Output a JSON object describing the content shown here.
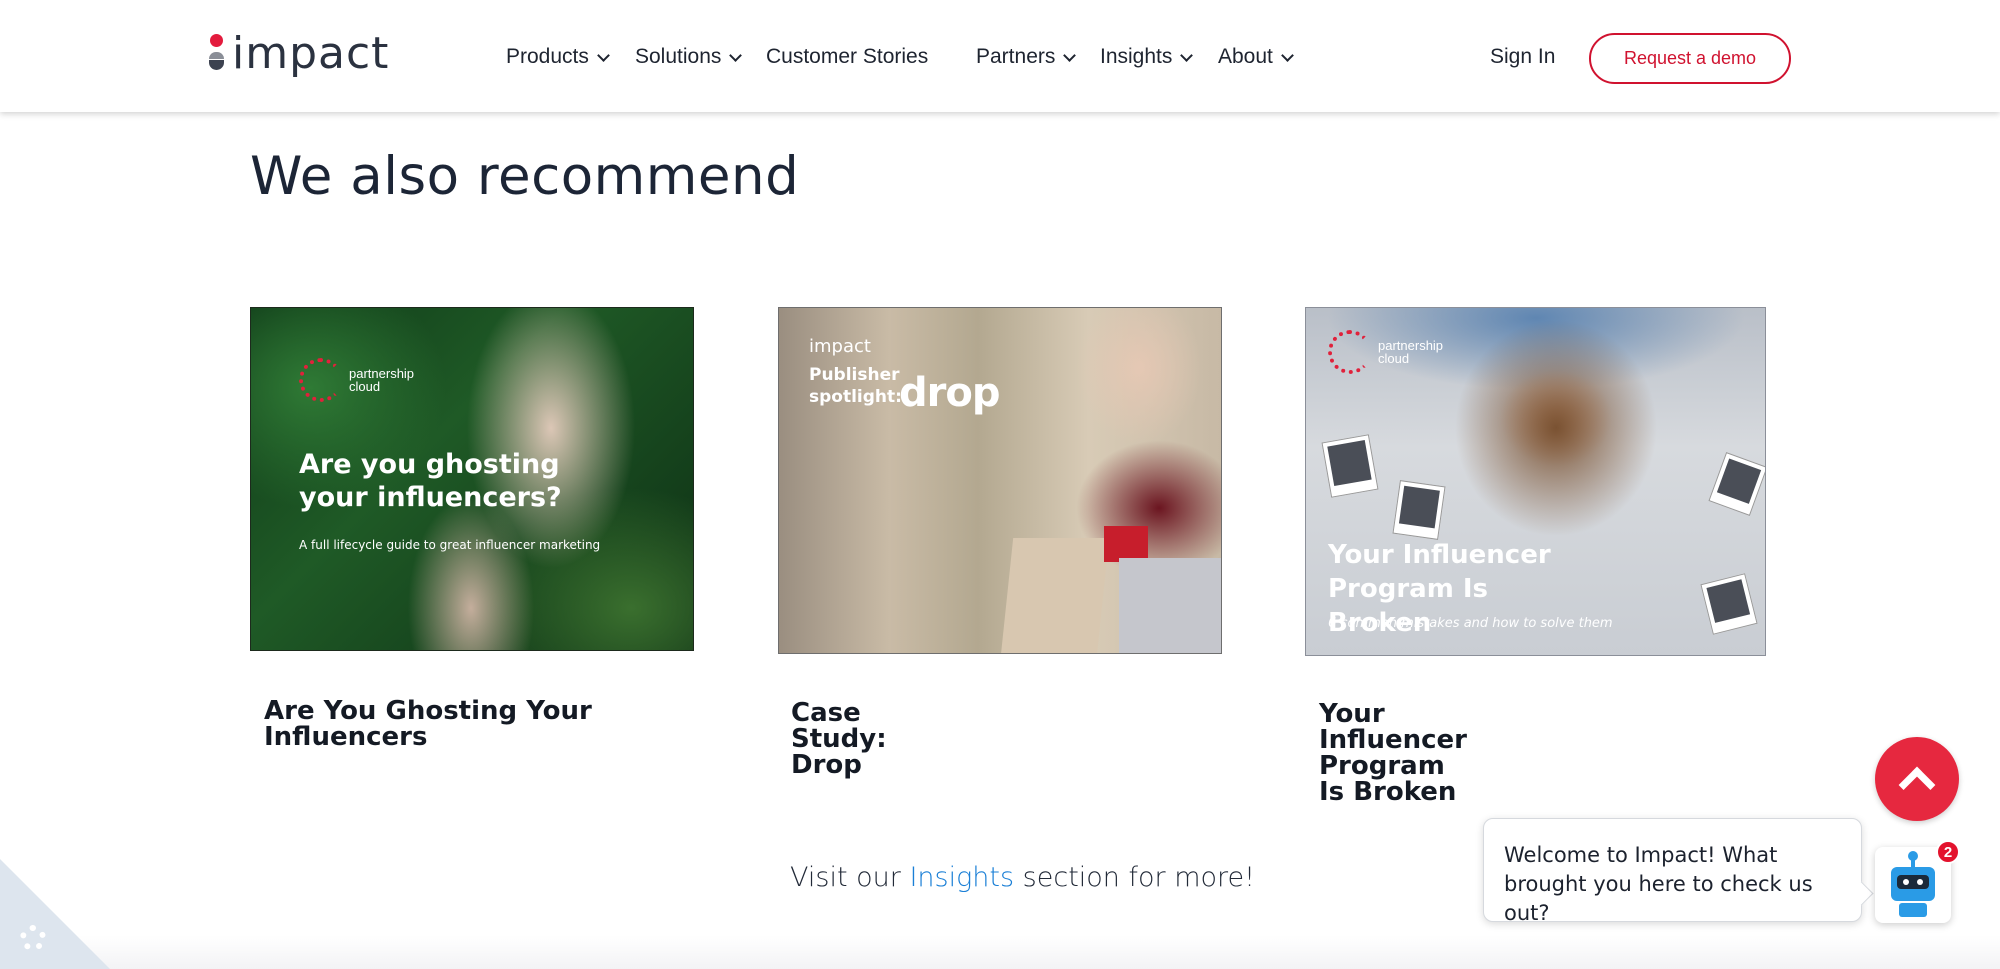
{
  "header": {
    "logo_text": "impact",
    "nav": [
      {
        "label": "Products",
        "has_dropdown": true
      },
      {
        "label": "Solutions",
        "has_dropdown": true
      },
      {
        "label": "Customer Stories",
        "has_dropdown": false
      },
      {
        "label": "Partners",
        "has_dropdown": true
      },
      {
        "label": "Insights",
        "has_dropdown": true
      },
      {
        "label": "About",
        "has_dropdown": true
      }
    ],
    "sign_in": "Sign In",
    "demo_button": "Request a demo"
  },
  "main": {
    "section_title": "We also recommend",
    "cards": [
      {
        "title": "Are You Ghosting Your Influencers",
        "image": {
          "brand": "partnership cloud",
          "headline": "Are you ghosting your influencers?",
          "subline": "A full lifecycle guide to great influencer marketing"
        }
      },
      {
        "title": "Case Study: Drop",
        "image": {
          "brand": "impact",
          "headline": "Publisher spotlight:",
          "logo_word": "drop"
        }
      },
      {
        "title": "Your Influencer Program Is Broken",
        "image": {
          "brand": "partnership cloud",
          "headline": "Your Influencer Program Is Broken",
          "subline": "6 common mistakes and how to solve them"
        }
      }
    ],
    "visit_prefix": "Visit our",
    "visit_link": "Insights",
    "visit_suffix": "section for more!"
  },
  "chat": {
    "message": "Welcome to Impact! What brought you here to check us out?",
    "badge_count": "2"
  },
  "colors": {
    "brand_red": "#e31b3d",
    "link_blue": "#1a7fd6",
    "scroll_top": "#e6283f"
  },
  "icons": [
    "chevron-down-icon",
    "chevron-up-icon",
    "robot-icon",
    "gear-icon"
  ]
}
